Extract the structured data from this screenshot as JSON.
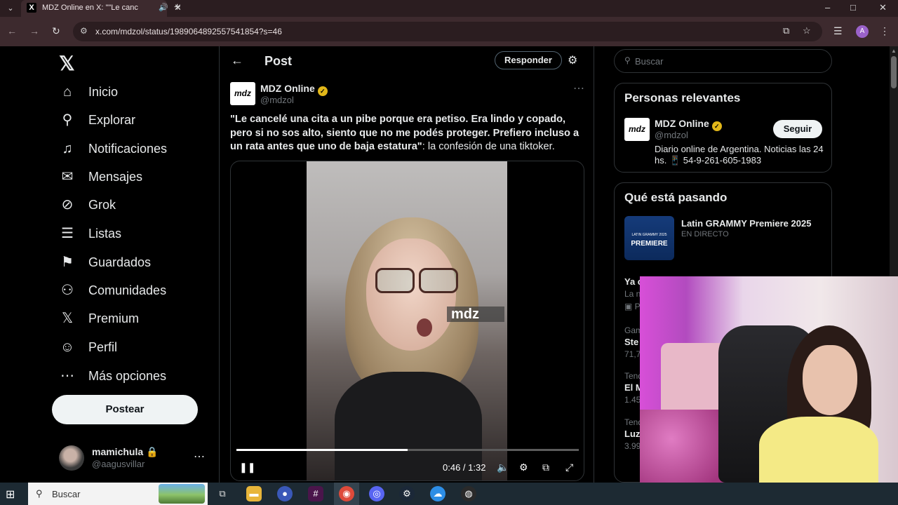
{
  "browser": {
    "tab_title": "MDZ Online en X: \"\"Le canc",
    "tab_favicon": "x-logo",
    "new_tab": "+",
    "url": "x.com/mdzol/status/1989064892557541854?s=46",
    "window_controls": [
      "–",
      "□",
      "✕"
    ],
    "profile_initial": "A"
  },
  "nav": {
    "items": [
      {
        "icon": "home-icon",
        "glyph": "⌂",
        "label": "Inicio"
      },
      {
        "icon": "search-icon",
        "glyph": "⚲",
        "label": "Explorar"
      },
      {
        "icon": "bell-icon",
        "glyph": "♫",
        "label": "Notificaciones"
      },
      {
        "icon": "mail-icon",
        "glyph": "✉",
        "label": "Mensajes"
      },
      {
        "icon": "grok-icon",
        "glyph": "⊘",
        "label": "Grok"
      },
      {
        "icon": "list-icon",
        "glyph": "☰",
        "label": "Listas"
      },
      {
        "icon": "bookmark-icon",
        "glyph": "⚑",
        "label": "Guardados"
      },
      {
        "icon": "communities-icon",
        "glyph": "⚇",
        "label": "Comunidades"
      },
      {
        "icon": "x-premium-icon",
        "glyph": "𝕏",
        "label": "Premium"
      },
      {
        "icon": "profile-icon",
        "glyph": "☺",
        "label": "Perfil"
      },
      {
        "icon": "more-icon",
        "glyph": "⋯",
        "label": "Más opciones"
      }
    ],
    "post_button": "Postear",
    "account": {
      "name": "mamichula 🔒",
      "handle": "@aagusvillar"
    }
  },
  "post": {
    "header_title": "Post",
    "reply_button": "Responder",
    "author": {
      "name": "MDZ Online",
      "handle": "@mdzol",
      "avatar_text": "mdz"
    },
    "text_bold": "\"Le cancelé una cita a un pibe porque era petiso. Era lindo y copado, pero si no sos alto, siento que no me podés proteger. Prefiero incluso a un rata antes que uno de baja estatura\"",
    "text_rest": ": la confesión de una tiktoker.",
    "video": {
      "watermark": "mdz",
      "time": "0:46 / 1:32",
      "progress": 0.5
    }
  },
  "right": {
    "search_placeholder": "Buscar",
    "relevant": {
      "title": "Personas relevantes",
      "name": "MDZ Online",
      "handle": "@mdzol",
      "follow": "Seguir",
      "bio": "Diario online de Argentina. Noticias las 24 hs. 📱 54-9-261-605-1983"
    },
    "trends": {
      "title": "Qué está pasando",
      "featured": {
        "title": "Latin GRAMMY Premiere 2025",
        "sub": "EN DIRECTO",
        "thumb_small": "LATIN GRAMMY 2025",
        "thumb_big": "PREMIERE"
      },
      "partial": [
        "Ya c",
        "La n",
        "▣ P",
        "Gam",
        "Ste",
        "71,7",
        "Tend",
        "El M",
        "1.45",
        "Tend",
        "Luz",
        "3.99"
      ]
    }
  },
  "taskbar": {
    "search_placeholder": "Buscar",
    "apps": [
      "task-view",
      "file-explorer",
      "app-blue",
      "slack",
      "chrome",
      "discord",
      "steam",
      "app-cloud",
      "obs"
    ]
  }
}
